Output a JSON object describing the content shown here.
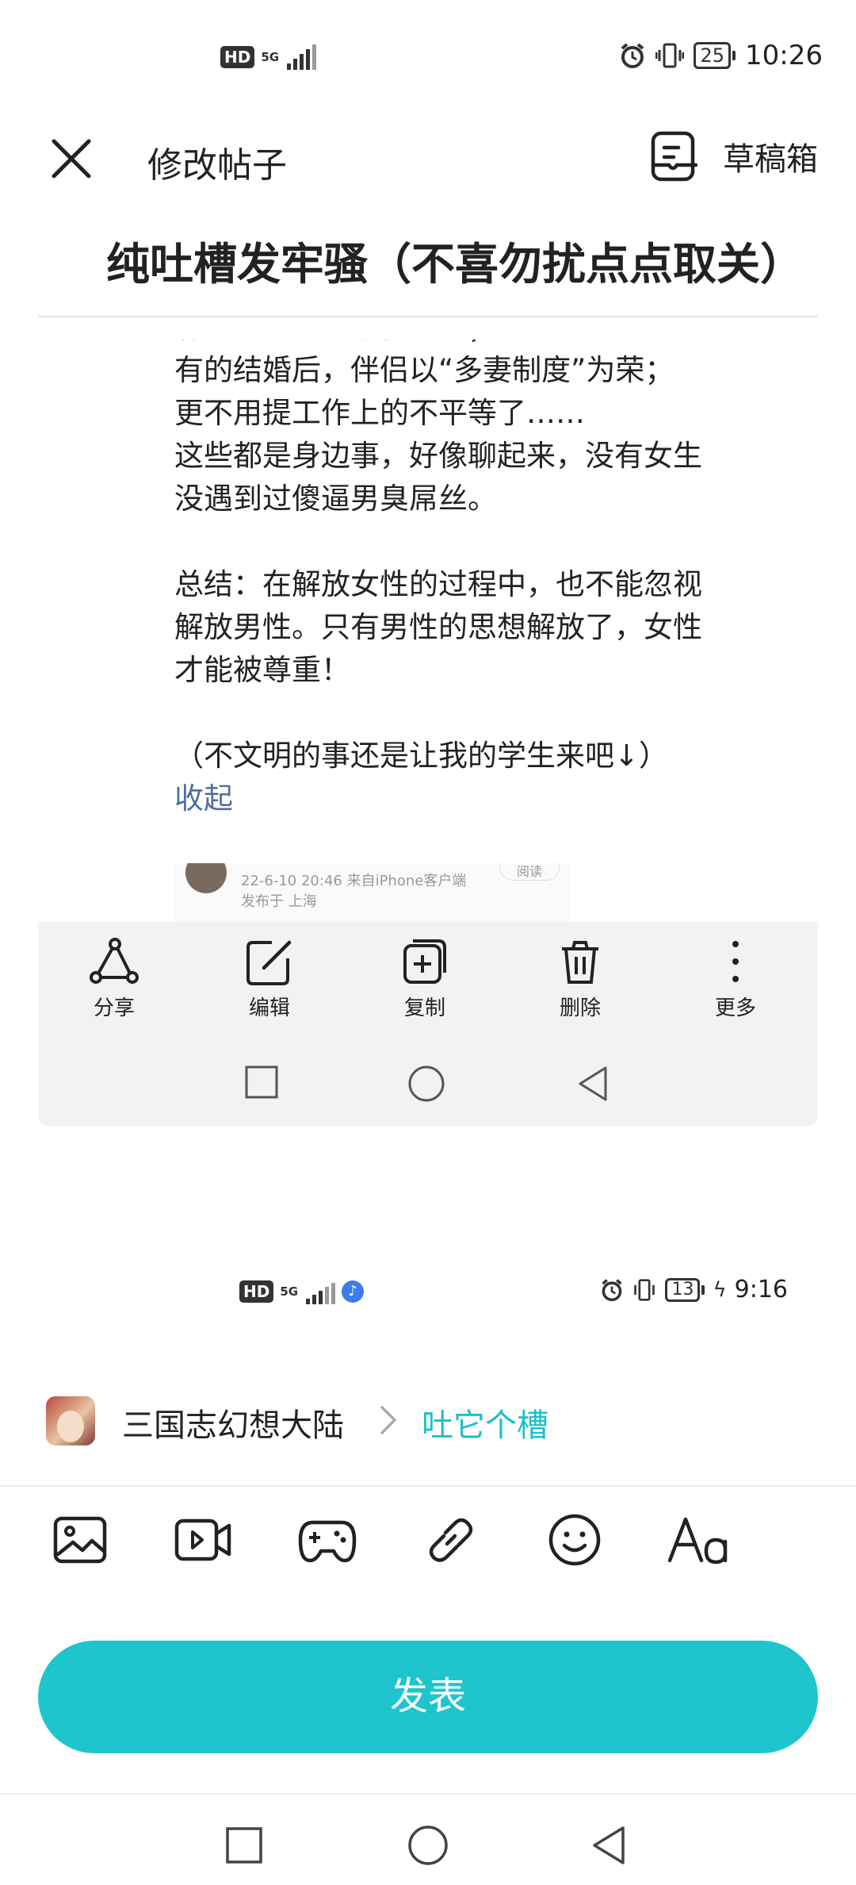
{
  "status_bar": {
    "hd": "HD",
    "network": "5G",
    "battery": "25",
    "time": "10:26"
  },
  "header": {
    "title": "修改帖子",
    "drafts_label": "草稿箱"
  },
  "post": {
    "title": "纯吐槽发牢骚（不喜勿扰点点取关）"
  },
  "embedded_screenshot": {
    "text_lines": [
      "有的在恋爱的不被尊重；",
      "有的结婚后，伴侣以“多妻制度”为荣；",
      "更不用提工作上的不平等了……",
      "这些都是身边事，好像聊起来，没有女生",
      "没遇到过傻逼男臭屌丝。",
      "",
      "总结：在解放女性的过程中，也不能忽视",
      "解放男性。只有男性的思想解放了，女性",
      "才能被尊重！",
      "",
      "（不文明的事还是让我的学生来吧↓）"
    ],
    "collapse_label": "收起",
    "thumbnail": {
      "meta_line1": "22-6-10 20:46  来自iPhone客户端",
      "meta_line2": "发布于 上海",
      "follow_label": "阅读"
    },
    "actions": [
      {
        "icon": "share-icon",
        "label": "分享"
      },
      {
        "icon": "edit-icon",
        "label": "编辑"
      },
      {
        "icon": "copy-icon",
        "label": "复制"
      },
      {
        "icon": "delete-icon",
        "label": "删除"
      },
      {
        "icon": "more-icon",
        "label": "更多"
      }
    ],
    "status_bar": {
      "hd": "HD",
      "network": "5G",
      "battery": "13",
      "time": "9:16"
    }
  },
  "forum": {
    "name": "三国志幻想大陆",
    "topic": "吐它个槽"
  },
  "toolbar": {
    "items": [
      "image-icon",
      "video-icon",
      "gamepad-icon",
      "link-icon",
      "emoji-icon",
      "text-format-icon"
    ]
  },
  "publish_label": "发表",
  "colors": {
    "accent": "#1ec5cc",
    "topic": "#1bbfc8",
    "link": "#4d6ea2"
  }
}
